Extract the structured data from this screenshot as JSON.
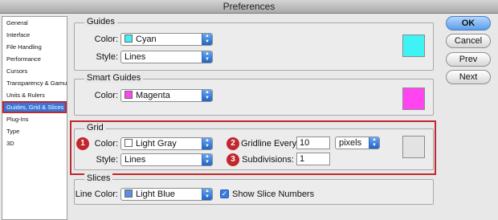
{
  "window": {
    "title": "Preferences"
  },
  "sidebar": {
    "items": [
      {
        "label": "General"
      },
      {
        "label": "Interface"
      },
      {
        "label": "File Handling"
      },
      {
        "label": "Performance"
      },
      {
        "label": "Cursors"
      },
      {
        "label": "Transparency & Gamut"
      },
      {
        "label": "Units & Rulers"
      },
      {
        "label": "Guides, Grid & Slices",
        "selected": true
      },
      {
        "label": "Plug-Ins"
      },
      {
        "label": "Type"
      },
      {
        "label": "3D"
      }
    ]
  },
  "guides": {
    "title": "Guides",
    "color_label": "Color:",
    "color_value": "Cyan",
    "color_hex": "#3ff3f5",
    "style_label": "Style:",
    "style_value": "Lines"
  },
  "smart_guides": {
    "title": "Smart Guides",
    "color_label": "Color:",
    "color_value": "Magenta",
    "color_hex": "#ff44f0"
  },
  "grid": {
    "title": "Grid",
    "color_label": "Color:",
    "color_value": "Light Gray",
    "color_hex": "#e3e3e3",
    "style_label": "Style:",
    "style_value": "Lines",
    "gridline_label": "Gridline Every:",
    "gridline_value": "10",
    "unit_value": "pixels",
    "subdivisions_label": "Subdivisions:",
    "subdivisions_value": "1",
    "badges": [
      "1",
      "2",
      "3"
    ]
  },
  "slices": {
    "title": "Slices",
    "line_color_label": "Line Color:",
    "line_color_value": "Light Blue",
    "line_color_hex": "#5b8ee6",
    "show_numbers_label": "Show Slice Numbers",
    "show_numbers_checked": true
  },
  "buttons": {
    "ok": "OK",
    "cancel": "Cancel",
    "prev": "Prev",
    "next": "Next"
  },
  "colors": {
    "accent_blue": "#3875d7",
    "highlight_red": "#c1272d"
  }
}
